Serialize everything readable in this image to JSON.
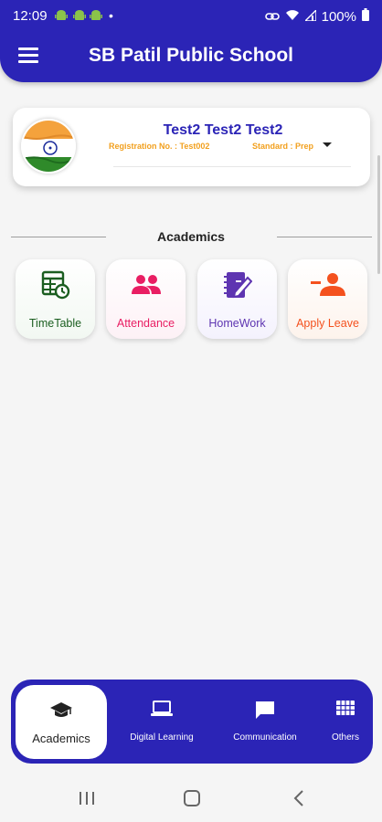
{
  "status_bar": {
    "time": "12:09",
    "battery": "100%",
    "dot": "•"
  },
  "header": {
    "title": "SB Patil Public School",
    "menu_icon": "hamburger-menu-icon",
    "color": "#2b24b6"
  },
  "profile": {
    "name": "Test2 Test2 Test2",
    "registration_label": "Registration No. : Test002",
    "standard_label": "Standard : Prep",
    "avatar": "india-flag-avatar"
  },
  "section": {
    "title": "Academics"
  },
  "tiles": [
    {
      "label": "TimeTable",
      "icon": "timetable-icon",
      "color": "#1b5e20"
    },
    {
      "label": "Attendance",
      "icon": "attendance-people-icon",
      "color": "#e91e63"
    },
    {
      "label": "HomeWork",
      "icon": "homework-notebook-icon",
      "color": "#5e35b1"
    },
    {
      "label": "Apply Leave",
      "icon": "leave-person-icon",
      "color": "#f4511e"
    }
  ],
  "bottom_nav": [
    {
      "label": "Academics",
      "icon": "graduation-cap-icon",
      "active": true
    },
    {
      "label": "Digital Learning",
      "icon": "laptop-icon",
      "active": false
    },
    {
      "label": "Communication",
      "icon": "chat-bubble-icon",
      "active": false
    },
    {
      "label": "Others",
      "icon": "grid-icon",
      "active": false
    }
  ]
}
